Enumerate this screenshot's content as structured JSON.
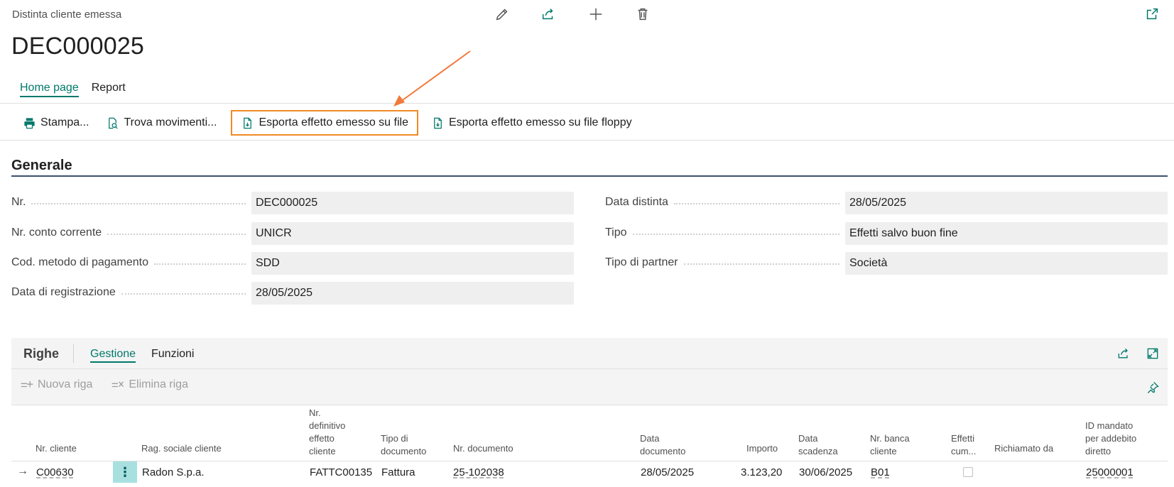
{
  "header": {
    "caption": "Distinta cliente emessa",
    "title": "DEC000025",
    "tabs": [
      "Home page",
      "Report"
    ]
  },
  "actions": {
    "print": "Stampa...",
    "find_entries": "Trova movimenti...",
    "export_file": "Esporta effetto emesso su file",
    "export_floppy": "Esporta effetto emesso su file floppy"
  },
  "general": {
    "section_title": "Generale",
    "left": [
      {
        "label": "Nr.",
        "value": "DEC000025"
      },
      {
        "label": "Nr. conto corrente",
        "value": "UNICR"
      },
      {
        "label": "Cod. metodo di pagamento",
        "value": "SDD"
      },
      {
        "label": "Data di registrazione",
        "value": "28/05/2025"
      }
    ],
    "right": [
      {
        "label": "Data distinta",
        "value": "28/05/2025"
      },
      {
        "label": "Tipo",
        "value": "Effetti salvo buon fine"
      },
      {
        "label": "Tipo di partner",
        "value": "Società"
      }
    ]
  },
  "lines": {
    "title": "Righe",
    "tabs": [
      "Gestione",
      "Funzioni"
    ],
    "new_line": "Nuova riga",
    "delete_line": "Elimina riga",
    "columns": {
      "customer_no": "Nr. cliente",
      "customer_name": "Rag. sociale cliente",
      "final_bill_no_1": "Nr.",
      "final_bill_no_2": "definitivo",
      "final_bill_no_3": "effetto",
      "final_bill_no_4": "cliente",
      "doc_type_1": "Tipo di",
      "doc_type_2": "documento",
      "doc_no": "Nr. documento",
      "doc_date_1": "Data",
      "doc_date_2": "documento",
      "amount": "Importo",
      "due_date_1": "Data",
      "due_date_2": "scadenza",
      "bank_1": "Nr. banca",
      "bank_2": "cliente",
      "cum_1": "Effetti",
      "cum_2": "cum...",
      "recalled_by": "Richiamato da",
      "mandate_1": "ID mandato",
      "mandate_2": "per addebito",
      "mandate_3": "diretto"
    },
    "rows": [
      {
        "customer_no": "C00630",
        "customer_name": "Radon S.p.a.",
        "final_bill_no": "FATTC00135",
        "doc_type": "Fattura",
        "doc_no": "25-102038",
        "doc_date": "28/05/2025",
        "amount": "3.123,20",
        "due_date": "30/06/2025",
        "bank": "B01",
        "cumulative": false,
        "recalled_by": "",
        "mandate_id": "25000001"
      }
    ]
  },
  "colors": {
    "accent": "#00796b",
    "highlight_border": "#f08a24",
    "annotation_arrow": "#f07a3c",
    "field_bg": "#efefef",
    "section_line": "#3d4f6e"
  }
}
